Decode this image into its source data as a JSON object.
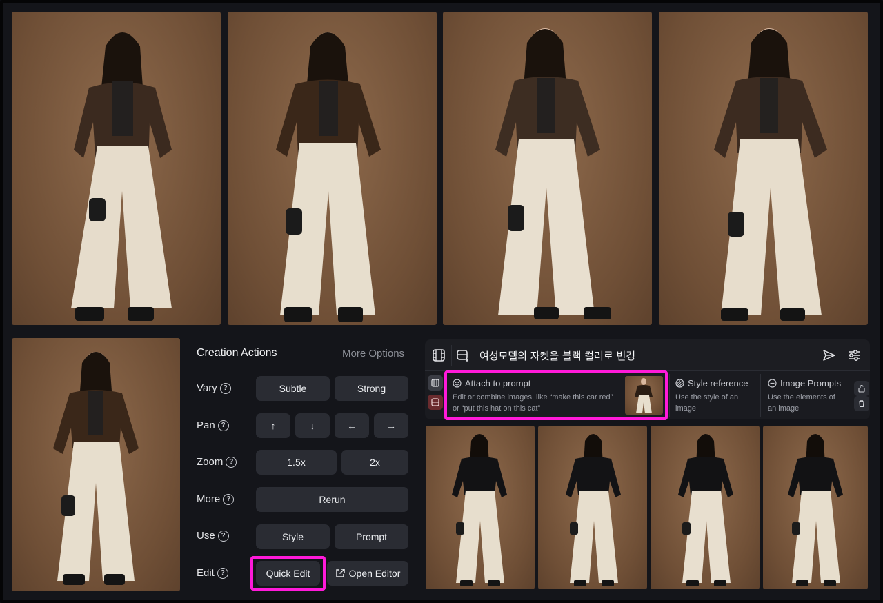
{
  "colors": {
    "highlight": "#ff1ad9",
    "button_bg": "#2a2c33",
    "photo_bg": "#7a5a40"
  },
  "panel": {
    "title": "Creation Actions",
    "more_options": "More Options",
    "rows": {
      "vary": {
        "label": "Vary",
        "buttons": [
          "Subtle",
          "Strong"
        ]
      },
      "pan": {
        "label": "Pan",
        "buttons": [
          "↑",
          "↓",
          "←",
          "→"
        ]
      },
      "zoom": {
        "label": "Zoom",
        "buttons": [
          "1.5x",
          "2x"
        ]
      },
      "more": {
        "label": "More",
        "buttons": [
          "Rerun"
        ]
      },
      "use": {
        "label": "Use",
        "buttons": [
          "Style",
          "Prompt"
        ]
      },
      "edit": {
        "label": "Edit",
        "buttons": [
          "Quick Edit",
          "Open Editor"
        ]
      }
    },
    "help_glyph": "?"
  },
  "prompt": {
    "text": "여성모델의 자켓을 블랙 컬러로 변경",
    "icons": [
      "film-icon",
      "image-add-icon",
      "send-icon",
      "sliders-icon"
    ]
  },
  "references": {
    "attach": {
      "title": "Attach to prompt",
      "desc_line1": "Edit or combine images, like “make this car red”",
      "desc_line2": "or “put this hat on this cat”"
    },
    "style": {
      "title": "Style reference",
      "desc_line1": "Use the style of an",
      "desc_line2": "image"
    },
    "image": {
      "title": "Image Prompts",
      "desc_line1": "Use the elements of",
      "desc_line2": "an image"
    }
  }
}
